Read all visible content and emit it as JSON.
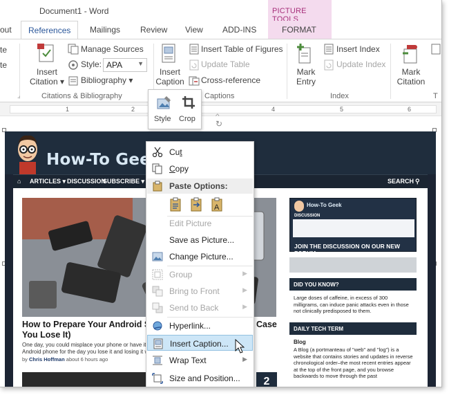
{
  "window": {
    "title": "Document1 - Word"
  },
  "contextual_tab": {
    "group_title": "PICTURE TOOLS",
    "tab": "FORMAT"
  },
  "tabs": [
    "out",
    "References",
    "Mailings",
    "Review",
    "View",
    "ADD-INS"
  ],
  "active_tab": "References",
  "ribbon": {
    "left_cut_items": [
      "te",
      "te"
    ],
    "citations": {
      "insert_citation": "Insert Citation",
      "insert_citation_line1": "Insert",
      "insert_citation_line2": "Citation",
      "manage_sources": "Manage Sources",
      "style_label": "Style:",
      "style_value": "APA",
      "bibliography": "Bibliography",
      "group_label": "Citations & Bibliography"
    },
    "captions": {
      "insert_caption_line1": "Insert",
      "insert_caption_line2": "Caption",
      "insert_table_of_figures": "Insert Table of Figures",
      "update_table": "Update Table",
      "cross_reference": "Cross-reference",
      "group_label": "Captions"
    },
    "index": {
      "mark_entry_line1": "Mark",
      "mark_entry_line2": "Entry",
      "insert_index": "Insert Index",
      "update_index": "Update Index",
      "group_label": "Index"
    },
    "table_of_authorities": {
      "mark_citation_line1": "Mark",
      "mark_citation_line2": "Citation",
      "group_label_cut": "T"
    }
  },
  "ruler": {
    "numbers": [
      "1",
      "2",
      "3",
      "4",
      "5",
      "6"
    ]
  },
  "mini_toolbar": {
    "style_label": "Style",
    "crop_label": "Crop"
  },
  "context_menu": {
    "items": [
      {
        "label": "Cut",
        "u": "t",
        "icon": "scissors-icon",
        "enabled": true
      },
      {
        "label": "Copy",
        "u": "C",
        "icon": "copy-icon",
        "enabled": true
      }
    ],
    "paste_header": "Paste Options:",
    "items2": [
      {
        "label": "Edit Picture",
        "icon": "",
        "enabled": false
      },
      {
        "label": "Save as Picture...",
        "icon": "",
        "enabled": true
      },
      {
        "label": "Change Picture...",
        "icon": "change-picture-icon",
        "enabled": true
      },
      {
        "label": "Group",
        "icon": "group-icon",
        "enabled": false,
        "submenu": true
      },
      {
        "label": "Bring to Front",
        "icon": "bring-to-front-icon",
        "enabled": false,
        "submenu": true
      },
      {
        "label": "Send to Back",
        "icon": "send-to-back-icon",
        "enabled": false,
        "submenu": true
      },
      {
        "label": "Hyperlink...",
        "icon": "hyperlink-icon",
        "enabled": true
      },
      {
        "label": "Insert Caption...",
        "icon": "insert-caption-icon",
        "enabled": true,
        "highlighted": true
      },
      {
        "label": "Wrap Text",
        "icon": "wrap-text-icon",
        "enabled": true,
        "submenu": true
      },
      {
        "label": "Size and Position...",
        "icon": "size-position-icon",
        "enabled": true
      }
    ]
  },
  "picture": {
    "site_name": "How-To Geek",
    "nav": [
      "ARTICLES",
      "DISCUSSION",
      "SUBSCRIBE",
      "SEARCH"
    ],
    "article_title": "How to Prepare Your Android Sm",
    "article_title_right": "Case",
    "article_title_line2": "You Lose It)",
    "article_body": "One day, you could misplace your phone or have it sto",
    "article_body_line2": "Android phone for the day you lose it and losing it will",
    "byline_by": "by",
    "byline_author": "Chris Hoffman",
    "byline_time": "about 6 hours ago",
    "number_badge": "2",
    "sidebar": {
      "forum_logo": "How-To Geek",
      "forum_sub": "DISCUSSION",
      "forum_cta": "JOIN THE DISCUSSION ON OUR NEW FORUM",
      "dyk_head": "DID YOU KNOW?",
      "dyk_text": "Large doses of caffeine, in excess of 300 milligrams, can induce panic attacks even in those not clinically predisposed to them.",
      "term_head": "DAILY TECH TERM",
      "term_title": "Blog",
      "term_text": "A Blog (a portmanteau of \"web\" and \"log\") is a website that contains stories and updates in reverse chronological order–the most recent entries appear at the top of the front page, and you browse backwards to move through the past"
    }
  },
  "colors": {
    "accent": "#2b579a",
    "contextual": "#a7307b",
    "contextual_bg": "#f4dbee",
    "highlight": "#cde6f7"
  }
}
